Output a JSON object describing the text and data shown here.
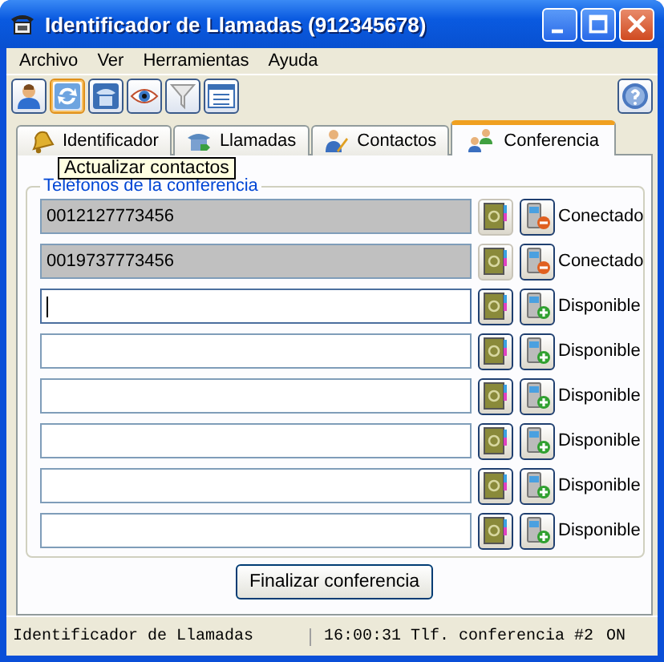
{
  "window": {
    "title": "Identificador de Llamadas (912345678)"
  },
  "menu": [
    "Archivo",
    "Ver",
    "Herramientas",
    "Ayuda"
  ],
  "toolbar": [
    {
      "kind": "person",
      "hovered": false
    },
    {
      "kind": "refresh",
      "hovered": true
    },
    {
      "kind": "phone",
      "hovered": false
    },
    {
      "kind": "eye",
      "hovered": false
    },
    {
      "kind": "filter",
      "hovered": false
    },
    {
      "kind": "list",
      "hovered": false
    }
  ],
  "tooltip": "Actualizar contactos",
  "tabs": [
    {
      "label": "Identificador",
      "kind": "bell",
      "selected": false
    },
    {
      "label": "Llamadas",
      "kind": "phone",
      "selected": false
    },
    {
      "label": "Contactos",
      "kind": "contact",
      "selected": false
    },
    {
      "label": "Conferencia",
      "kind": "people",
      "selected": true
    }
  ],
  "group": {
    "title": "Teléfonos de la conferencia"
  },
  "rows": [
    {
      "value": "0012127773456",
      "connected": true,
      "focused": false,
      "status": "Conectado"
    },
    {
      "value": "0019737773456",
      "connected": true,
      "focused": false,
      "status": "Conectado"
    },
    {
      "connected": false,
      "focused": true,
      "status": "Disponible"
    },
    {
      "connected": false,
      "focused": false,
      "status": "Disponible"
    },
    {
      "connected": false,
      "focused": false,
      "status": "Disponible"
    },
    {
      "connected": false,
      "focused": false,
      "status": "Disponible"
    },
    {
      "connected": false,
      "focused": false,
      "status": "Disponible"
    },
    {
      "connected": false,
      "focused": false,
      "status": "Disponible"
    }
  ],
  "end_button": "Finalizar conferencia",
  "status_bar": {
    "left": "Identificador de Llamadas",
    "right": "16:00:31 Tlf. conferencia #2",
    "state": "ON"
  }
}
